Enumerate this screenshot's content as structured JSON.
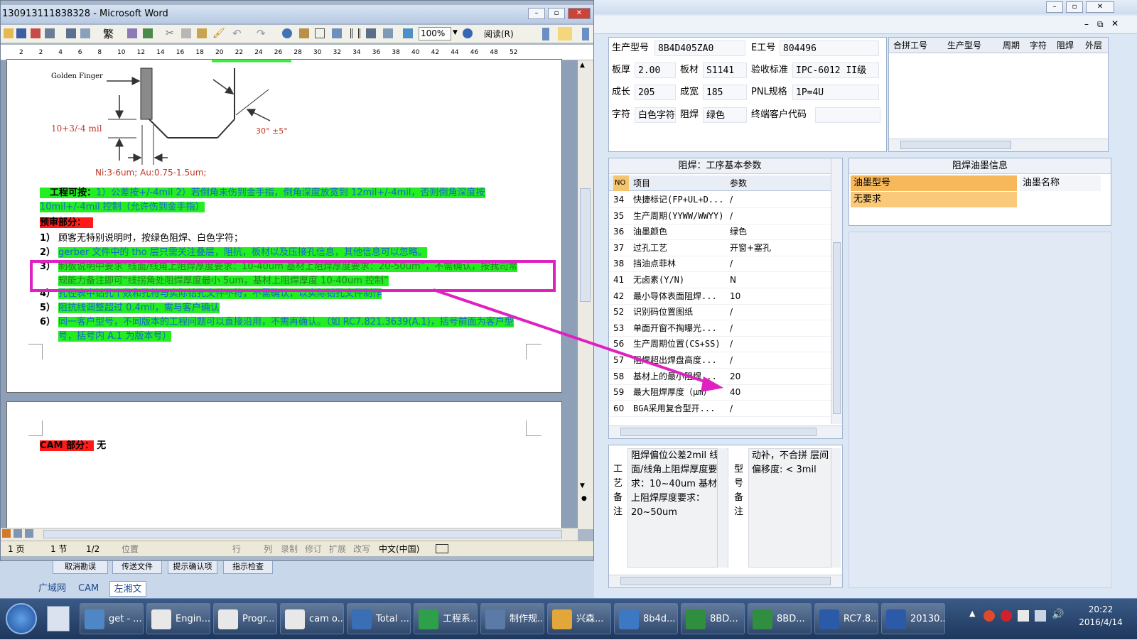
{
  "word": {
    "title": "130913111838328 - Microsoft Word",
    "toolbar": {
      "zoom": "100%",
      "read_label": "阅读(R)",
      "convert_label": "繁"
    },
    "ruler_numbers": [
      "2",
      "2",
      "4",
      "6",
      "8",
      "10",
      "12",
      "14",
      "16",
      "18",
      "20",
      "22",
      "24",
      "26",
      "28",
      "30",
      "32",
      "34",
      "36",
      "38",
      "40",
      "42",
      "44",
      "46",
      "48",
      "52"
    ],
    "figure": {
      "label_finger": "Golden Finger",
      "label_width": "10+3/-4 mil",
      "label_angle": "30°  ±5°",
      "label_plating": "Ni:3-6um; Au:0.75-1.5um;"
    },
    "content": {
      "heading1": "工程可按：",
      "para1": "1）公差按+/-4mil   2）若倒角未伤到金手指，倒角深度放宽到 12mil+/-4mil，否则倒角深度按 10mil+/-4mil 控制（允许伤到金手指）",
      "heading2": "预审部分：",
      "items": [
        {
          "num": "1）",
          "text": "顾客无特别说明时，按绿色阻焊、白色字符；"
        },
        {
          "num": "2）",
          "text": "gerber 文件中的 tho 层只需关注叠层，阻抗，板材以及压接孔信息，其他信息可以忽略。"
        },
        {
          "num": "3）",
          "text": "制板说明中要求“线面/线角上阻焊厚度要求：10-40um 基材上阻焊厚度要求：20-50um”，不需确认，按我司常规能力备注即可“线拐角处阻焊厚度最小 5um，基材上阻焊厚度 10-40um 控制”"
        },
        {
          "num": "4）",
          "text": "孔径表中钻孔个数和孔符与实际钻孔文件不符，不需确认，以实际钻孔文件制作"
        },
        {
          "num": "5）",
          "text": "阻抗线调整超过 0.4mil，需与客户确认"
        },
        {
          "num": "6）",
          "text": "同一客户型号，不同版本的工程问题可以直接沿用，不需再确认。（如 RC7.821.3639(A.1)，括号前面为客户型号，括号内 A.1 为版本号）"
        }
      ],
      "cam_heading": "CAM 部分：",
      "cam_value": "无"
    },
    "status": {
      "page": "1 页",
      "section": "1 节",
      "pages": "1/2",
      "position": "位置",
      "line": "行",
      "col": "列",
      "rec": "录制",
      "rev": "修订",
      "ext": "扩展",
      "ovr": "改写",
      "lang": "中文(中国)"
    }
  },
  "right_app": {
    "info": {
      "model_label": "生产型号",
      "model_value": "8B4D405ZA0",
      "eno_label": "E工号",
      "eno_value": "804496",
      "thickness_label": "板厚",
      "thickness_value": "2.00",
      "material_label": "板材",
      "material_value": "S1141",
      "standard_label": "验收标准",
      "standard_value": "IPC-6012 II级",
      "length_label": "成长",
      "length_value": "205",
      "width_label": "成宽",
      "width_value": "185",
      "pnl_label": "PNL规格",
      "pnl_value": "1P=4U",
      "silk_label": "字符",
      "silk_value": "白色字符",
      "mask_label": "阻焊",
      "mask_value": "绿色",
      "enduser_label": "终端客户代码",
      "enduser_value": ""
    },
    "merge_table": {
      "headers": [
        "合拼工号",
        "生产型号",
        "周期",
        "字符",
        "阻焊",
        "外层"
      ]
    },
    "param_panel": {
      "title": "阻焊：工序基本参数",
      "headers": [
        "NO",
        "项目",
        "参数"
      ],
      "rows": [
        {
          "no": "34",
          "item": "快捷标记(FP+UL+D...",
          "value": "/"
        },
        {
          "no": "35",
          "item": "生产周期(YYWW/WWYY)",
          "value": "/"
        },
        {
          "no": "36",
          "item": "油墨颜色",
          "value": "绿色"
        },
        {
          "no": "37",
          "item": "过孔工艺",
          "value": "开窗+塞孔"
        },
        {
          "no": "38",
          "item": "挡油点菲林",
          "value": "/"
        },
        {
          "no": "41",
          "item": "无卤素(Y/N)",
          "value": "N"
        },
        {
          "no": "42",
          "item": "最小导体表面阻焊...",
          "value": "10"
        },
        {
          "no": "52",
          "item": "识别码位置图纸",
          "value": "/"
        },
        {
          "no": "53",
          "item": "单面开窗不掏曝光...",
          "value": "/"
        },
        {
          "no": "56",
          "item": "生产周期位置(CS+SS)",
          "value": "/"
        },
        {
          "no": "57",
          "item": "阻焊超出焊盘高度...",
          "value": "/"
        },
        {
          "no": "58",
          "item": "基材上的最小阻焊...",
          "value": "20"
        },
        {
          "no": "59",
          "item": "最大阻焊厚度（μm）",
          "value": "40"
        },
        {
          "no": "60",
          "item": "BGA采用复合型开...",
          "value": "/"
        }
      ]
    },
    "ink_panel": {
      "title": "阻焊油墨信息",
      "headers": [
        "油墨型号",
        "油墨名称"
      ],
      "rows": [
        {
          "type": "无要求",
          "name": ""
        }
      ]
    },
    "process_note": {
      "label": "工艺备注",
      "text": "阻焊偏位公差2mil 线面/线角上阻焊厚度要求：10~40um 基材上阻焊厚度要求：20~50um"
    },
    "model_note": {
      "label": "型号备注",
      "text": "动补，不合拼 层间偏移度: < 3mil"
    }
  },
  "background": {
    "buttons": [
      "取消勘误",
      "传送文件",
      "提示确认项",
      "指示检查"
    ],
    "tabs": [
      "广域网",
      "CAM",
      "左湘文"
    ],
    "title_fragment": "工程系统"
  },
  "taskbar": {
    "items": [
      "get - ...",
      "Engin...",
      "Progr...",
      "cam o...",
      "Total ...",
      "工程系...",
      "制作规...",
      "兴森...",
      "8b4d...",
      "8BD...",
      "8BD...",
      "RC7.8...",
      "20130..."
    ],
    "clock_time": "20:22",
    "clock_date": "2016/4/14"
  },
  "colors": {
    "highlight": "#22ee22",
    "red_highlight": "#ff1a1a",
    "annotation": "#e020c0",
    "ink_row": "#fbc97a"
  }
}
